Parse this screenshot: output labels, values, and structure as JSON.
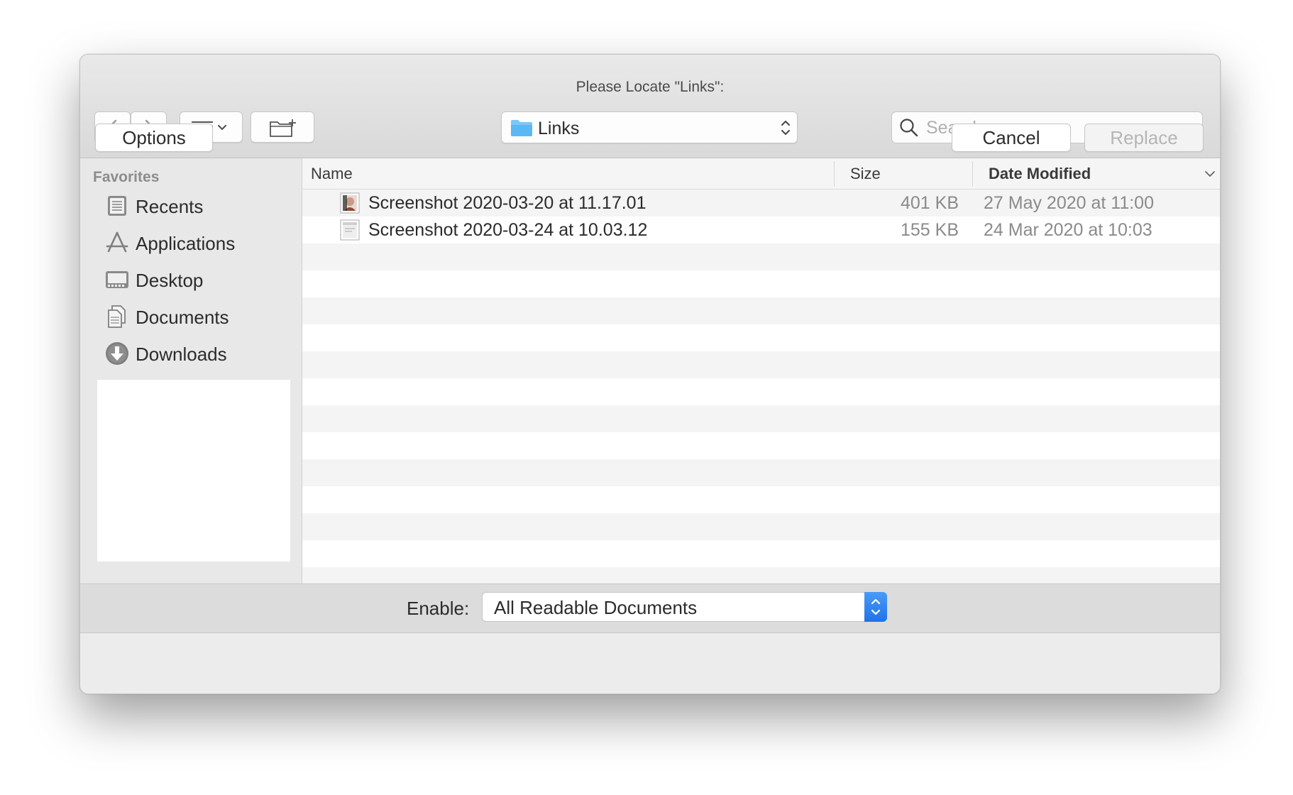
{
  "dialog": {
    "title": "Please Locate \"Links\":"
  },
  "toolbar": {
    "back_icon": "chevron-left-icon",
    "forward_icon": "chevron-right-icon",
    "view_icon": "list-view-icon",
    "new_folder_icon": "new-folder-icon",
    "location": "Links",
    "search_placeholder": "Search"
  },
  "sidebar": {
    "heading": "Favorites",
    "items": [
      {
        "label": "Recents",
        "icon": "clock-icon"
      },
      {
        "label": "Applications",
        "icon": "applications-icon"
      },
      {
        "label": "Desktop",
        "icon": "desktop-icon"
      },
      {
        "label": "Documents",
        "icon": "documents-icon"
      },
      {
        "label": "Downloads",
        "icon": "downloads-icon"
      }
    ]
  },
  "columns": {
    "name": "Name",
    "size": "Size",
    "date": "Date Modified"
  },
  "files": [
    {
      "name": "Screenshot 2020-03-20 at 11.17.01",
      "size": "401 KB",
      "date": "27 May 2020 at 11:00"
    },
    {
      "name": "Screenshot 2020-03-24 at 10.03.12",
      "size": "155 KB",
      "date": "24 Mar 2020 at 10:03"
    }
  ],
  "enable": {
    "label": "Enable:",
    "value": "All Readable Documents"
  },
  "buttons": {
    "options": "Options",
    "cancel": "Cancel",
    "replace": "Replace"
  },
  "colors": {
    "accent": "#1f73e6",
    "folder": "#5ab8f5"
  }
}
